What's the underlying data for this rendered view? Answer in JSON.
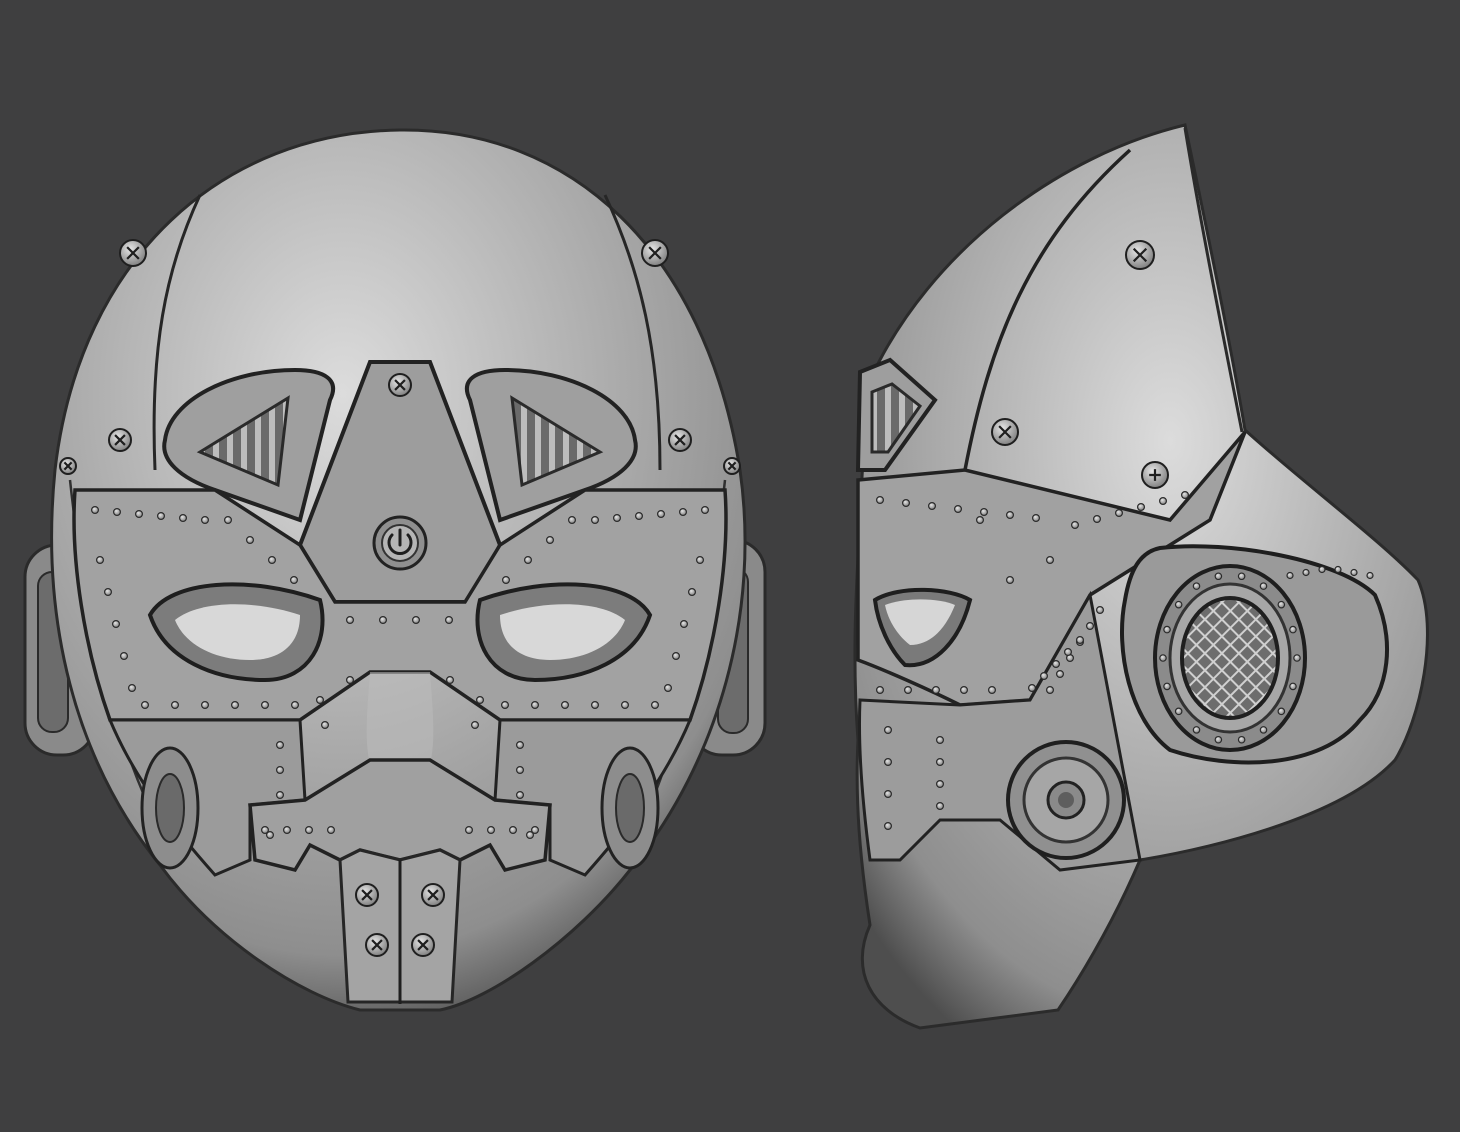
{
  "scene": {
    "background": "#3f3f40",
    "material": {
      "highlight": "#dcdcdc",
      "base": "#a9a9a9",
      "mid": "#8e8e8e",
      "shadow": "#4e4e4e",
      "seam": "#1f1f1f"
    },
    "objects": [
      {
        "name": "mask-front-view",
        "view": "front"
      },
      {
        "name": "mask-side-view",
        "view": "side"
      }
    ]
  }
}
